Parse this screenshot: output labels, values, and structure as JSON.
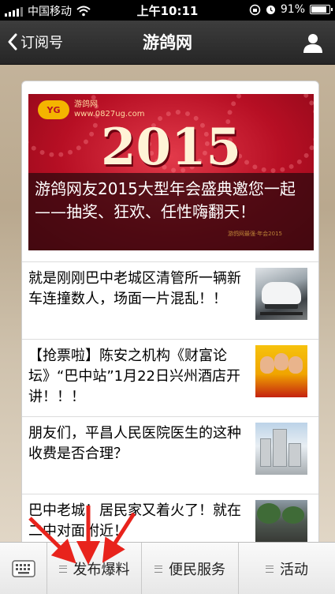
{
  "status_bar": {
    "carrier": "中国移动",
    "time": "上午10:11",
    "battery": "91%",
    "battery_level": 0.91
  },
  "nav": {
    "back_label": "订阅号",
    "title": "游鸽网"
  },
  "cover": {
    "logo_mark": "YG",
    "logo_name": "游鸽网",
    "logo_url": "www.0827ug.com",
    "year": "2015",
    "caption": "游鸽网友2015大型年会盛典邀您一起——抽奖、狂欢、任性嗨翻天！",
    "sub_caption": "游鸽网最强·年会2015"
  },
  "articles": [
    {
      "title": "就是刚刚巴中老城区清管所一辆新车连撞数人，场面一片混乱！！"
    },
    {
      "title": "【抢票啦】陈安之机构《财富论坛》“巴中站”1月22日兴州酒店开讲！！！"
    },
    {
      "title": "朋友们，平昌人民医院医生的这种收费是否合理？"
    },
    {
      "title": "巴中老城！居民家又着火了！就在二中对面附近！"
    }
  ],
  "menu": {
    "items": [
      {
        "label": "发布爆料"
      },
      {
        "label": "便民服务"
      },
      {
        "label": "活动"
      }
    ]
  },
  "colors": {
    "arrow": "#e8231c",
    "nav_bg": "#2e2e2e",
    "cover_red": "#c8132a"
  }
}
